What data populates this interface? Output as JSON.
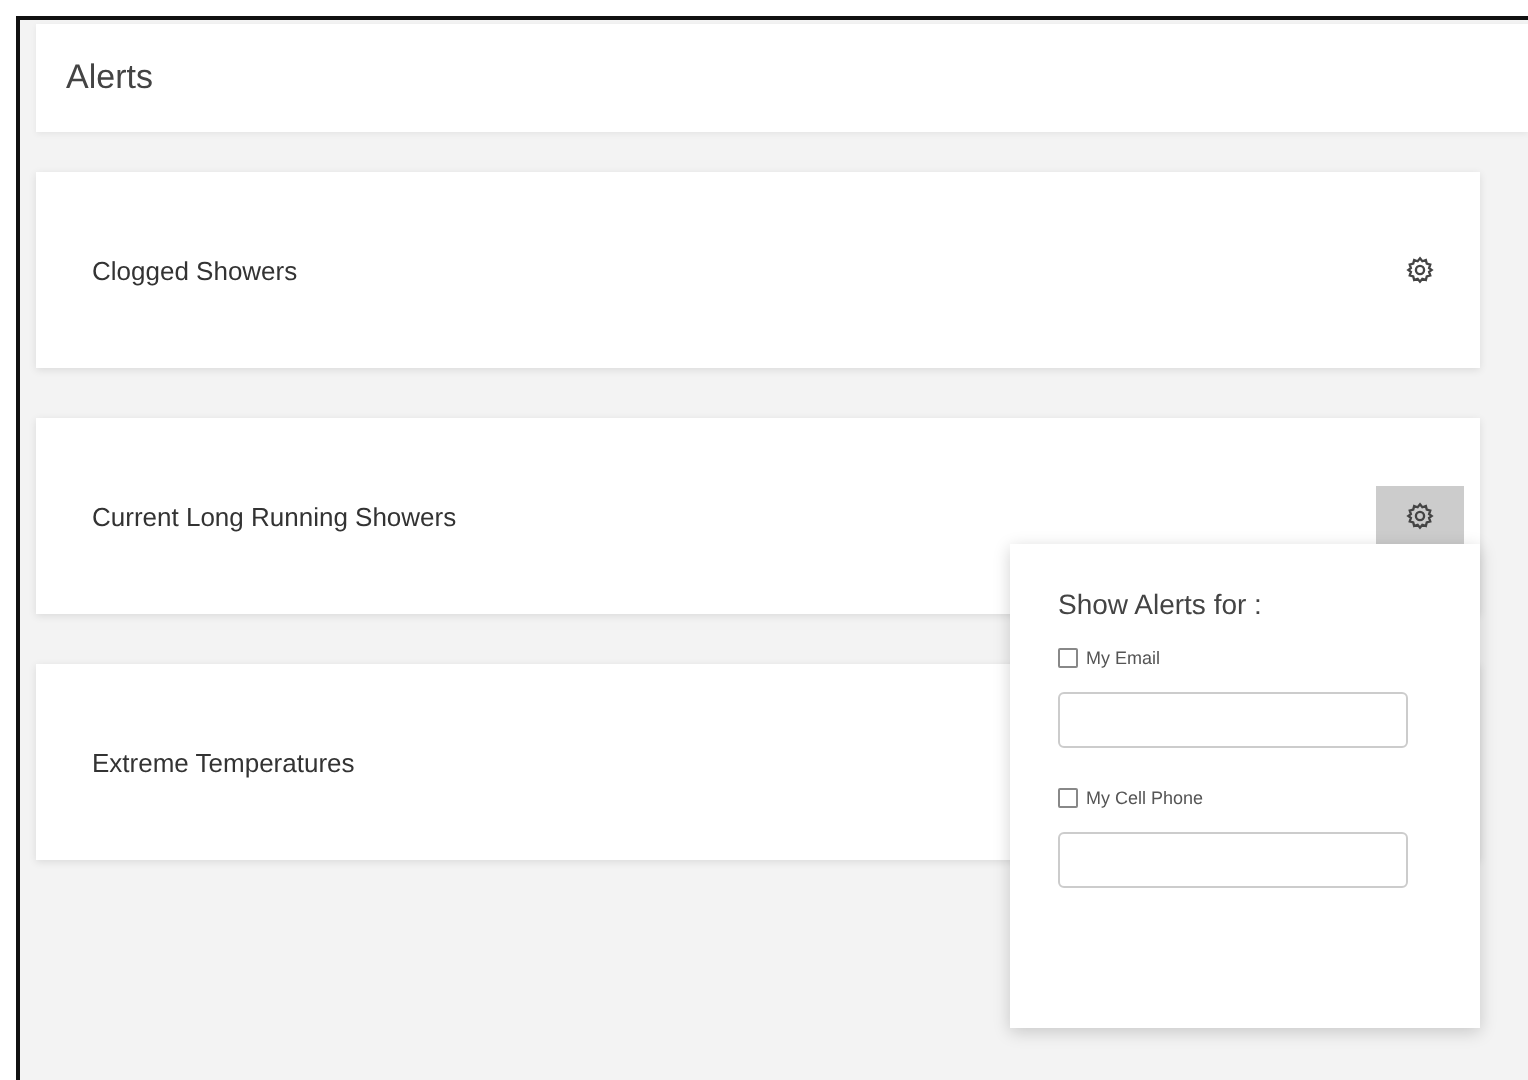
{
  "header": {
    "title": "Alerts"
  },
  "cards": [
    {
      "title": "Clogged Showers",
      "settings_open": false
    },
    {
      "title": "Current Long Running Showers",
      "settings_open": true
    },
    {
      "title": "Extreme Temperatures"
    }
  ],
  "popup": {
    "title": "Show Alerts for :",
    "options": [
      {
        "label": "My Email",
        "checked": false
      },
      {
        "label": "My Cell Phone",
        "checked": false
      }
    ]
  }
}
